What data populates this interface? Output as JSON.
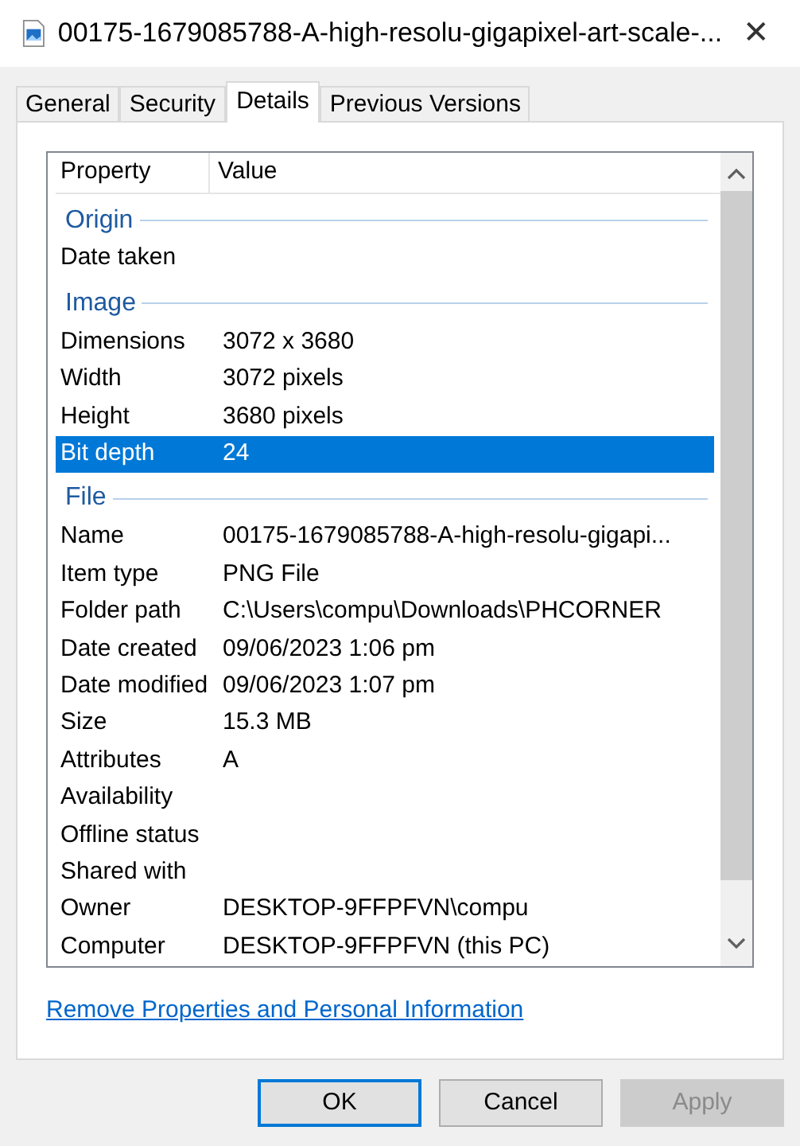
{
  "window": {
    "title": "00175-1679085788-A-high-resolu-gigapixel-art-scale-...",
    "close": "✕"
  },
  "tabs": [
    {
      "label": "General",
      "selected": false
    },
    {
      "label": "Security",
      "selected": false
    },
    {
      "label": "Details",
      "selected": true
    },
    {
      "label": "Previous Versions",
      "selected": false
    }
  ],
  "list": {
    "columns": [
      "Property",
      "Value"
    ],
    "rows": [
      {
        "kind": "group",
        "label": "Origin"
      },
      {
        "kind": "property",
        "property": "Date taken",
        "value": "",
        "selected": false
      },
      {
        "kind": "group",
        "label": "Image"
      },
      {
        "kind": "property",
        "property": "Dimensions",
        "value": "3072 x 3680",
        "selected": false
      },
      {
        "kind": "property",
        "property": "Width",
        "value": "3072 pixels",
        "selected": false
      },
      {
        "kind": "property",
        "property": "Height",
        "value": "3680 pixels",
        "selected": false
      },
      {
        "kind": "property",
        "property": "Bit depth",
        "value": "24",
        "selected": true
      },
      {
        "kind": "group",
        "label": "File"
      },
      {
        "kind": "property",
        "property": "Name",
        "value": "00175-1679085788-A-high-resolu-gigapi...",
        "selected": false
      },
      {
        "kind": "property",
        "property": "Item type",
        "value": "PNG File",
        "selected": false
      },
      {
        "kind": "property",
        "property": "Folder path",
        "value": "C:\\Users\\compu\\Downloads\\PHCORNER",
        "selected": false
      },
      {
        "kind": "property",
        "property": "Date created",
        "value": "09/06/2023 1:06 pm",
        "selected": false
      },
      {
        "kind": "property",
        "property": "Date modified",
        "value": "09/06/2023 1:07 pm",
        "selected": false
      },
      {
        "kind": "property",
        "property": "Size",
        "value": "15.3 MB",
        "selected": false
      },
      {
        "kind": "property",
        "property": "Attributes",
        "value": "A",
        "selected": false
      },
      {
        "kind": "property",
        "property": "Availability",
        "value": "",
        "selected": false
      },
      {
        "kind": "property",
        "property": "Offline status",
        "value": "",
        "selected": false
      },
      {
        "kind": "property",
        "property": "Shared with",
        "value": "",
        "selected": false
      },
      {
        "kind": "property",
        "property": "Owner",
        "value": "DESKTOP-9FFPFVN\\compu",
        "selected": false
      },
      {
        "kind": "property",
        "property": "Computer",
        "value": "DESKTOP-9FFPFVN (this PC)",
        "selected": false
      }
    ]
  },
  "link": "Remove Properties and Personal Information",
  "buttons": [
    {
      "label": "OK",
      "disabled": false,
      "default": true
    },
    {
      "label": "Cancel",
      "disabled": false,
      "default": false
    },
    {
      "label": "Apply",
      "disabled": true,
      "default": false
    }
  ]
}
